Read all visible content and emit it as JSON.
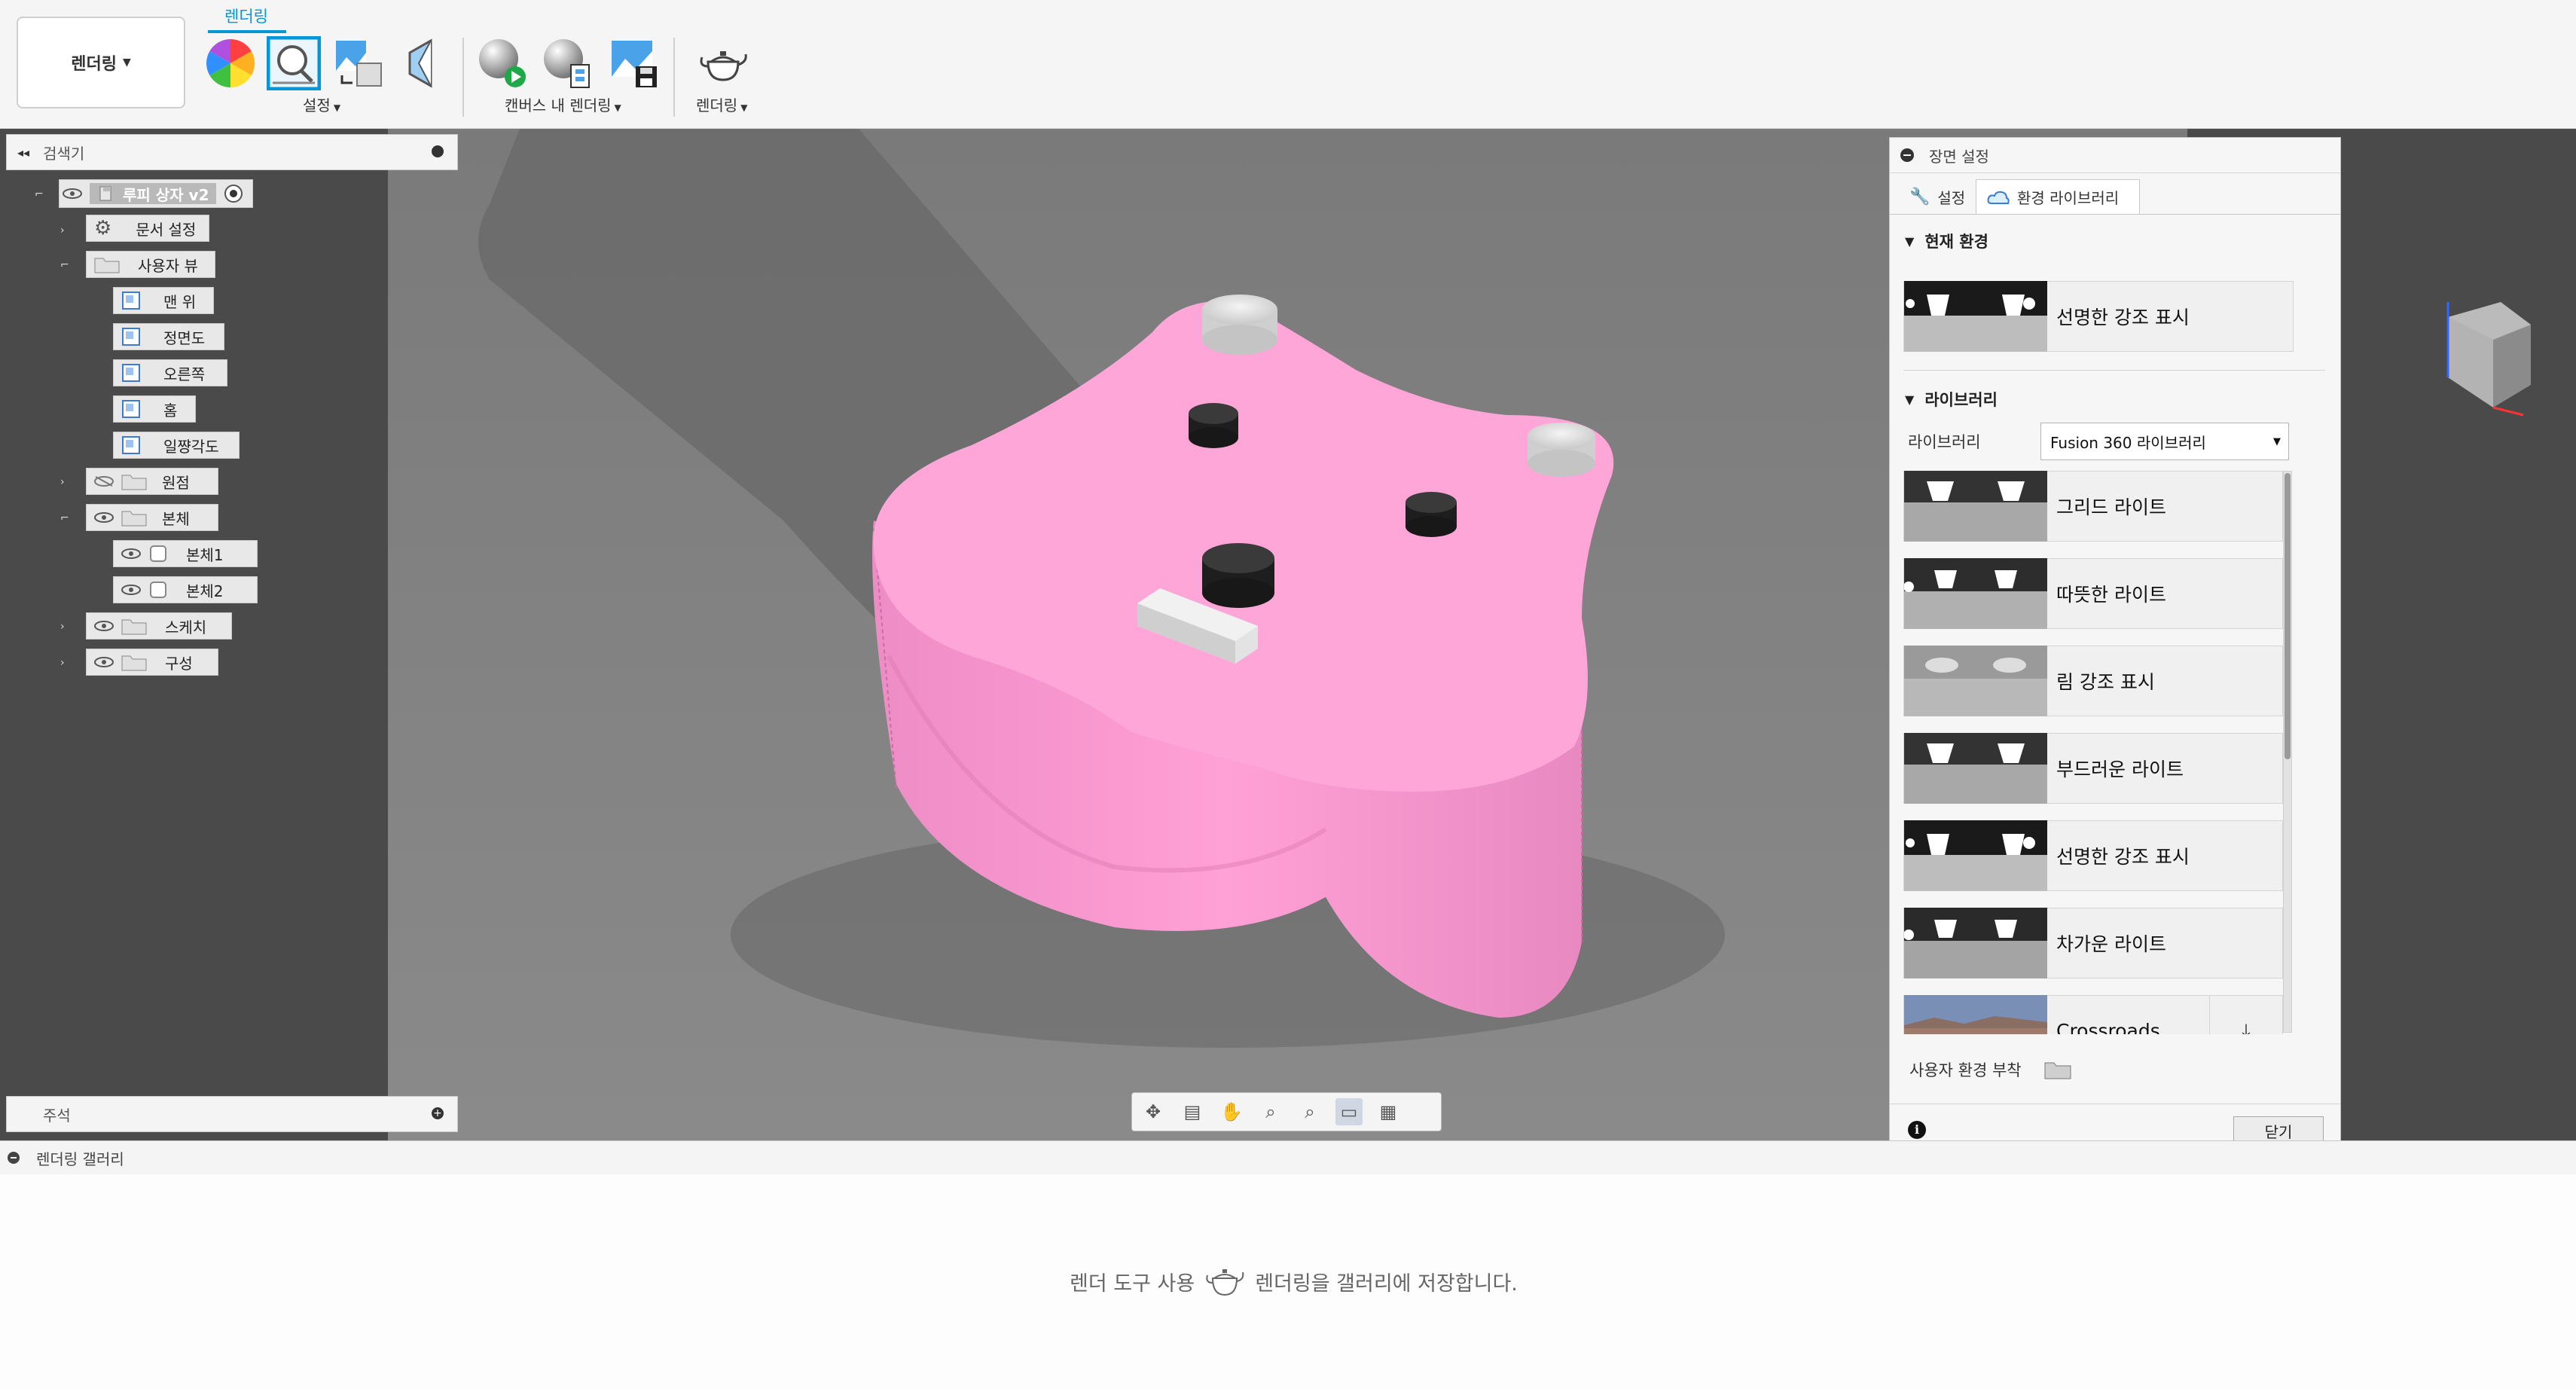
{
  "toolbar": {
    "workspace": "렌더링",
    "active_tab": "렌더링",
    "groups": {
      "setup": "설정",
      "in_canvas_render": "캔버스 내 렌더링",
      "render": "렌더링"
    }
  },
  "browser": {
    "title": "검색기",
    "items": [
      {
        "label": "루피 상자 v2"
      },
      {
        "label": "문서 설정"
      },
      {
        "label": "사용자 뷰"
      },
      {
        "label": "맨 위"
      },
      {
        "label": "정면도"
      },
      {
        "label": "오른쪽"
      },
      {
        "label": "홈"
      },
      {
        "label": "일쨩각도"
      },
      {
        "label": "원점"
      },
      {
        "label": "본체"
      },
      {
        "label": "본체1"
      },
      {
        "label": "본체2"
      },
      {
        "label": "스케치"
      },
      {
        "label": "구성"
      }
    ],
    "annotation": "주석"
  },
  "scene_settings": {
    "title": "장면 설정",
    "tabs": [
      "설정",
      "환경 라이브러리"
    ],
    "active_tab": "환경 라이브러리",
    "current_environment_header": "현재 환경",
    "current_environment": "선명한 강조 표시",
    "library_header": "라이브러리",
    "library_label": "라이브러리",
    "library_selected": "Fusion 360 라이브러리",
    "environments": [
      {
        "name": "그리드 라이트"
      },
      {
        "name": "따뜻한 라이트"
      },
      {
        "name": "림 강조 표시"
      },
      {
        "name": "부드러운 라이트"
      },
      {
        "name": "선명한 강조 표시"
      },
      {
        "name": "차가운 라이트"
      },
      {
        "name": "Crossroads"
      }
    ],
    "attach_custom": "사용자 환경 부착",
    "close": "닫기"
  },
  "gallery": {
    "title": "렌더링 갤러리",
    "msg_before": "렌더 도구 사용",
    "msg_after": "렌더링을 갤러리에 저장합니다."
  },
  "colors": {
    "accent": "#0696d7",
    "model_pink": "#ff9fd6",
    "viewport": "#7f7f7f"
  }
}
